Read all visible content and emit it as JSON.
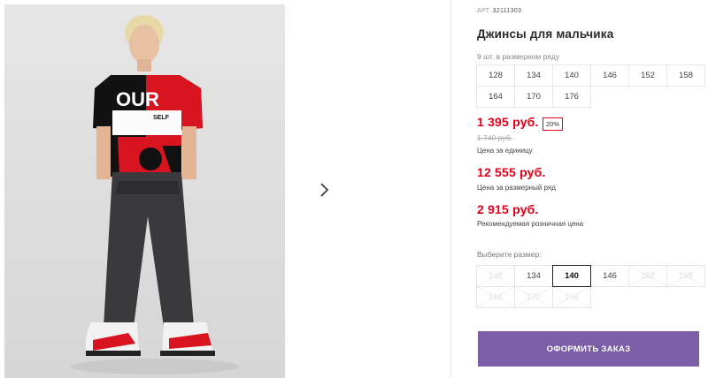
{
  "product": {
    "article_label": "АРТ.",
    "article_number": "32111303",
    "title": "Джинсы для мальчика",
    "series_note": "9 шт. в размерном ряду"
  },
  "series_sizes": [
    "128",
    "134",
    "140",
    "146",
    "152",
    "158",
    "164",
    "170",
    "176"
  ],
  "pricing": {
    "unit_price": "1 395 руб.",
    "discount": "20%",
    "old_price": "1 740 руб.",
    "unit_price_note": "Цена за единицу",
    "series_price": "12 555 руб.",
    "series_price_note": "Цена за размерный ряд",
    "retail_price": "2 915 руб.",
    "retail_price_note": "Рекомендуемая розничная цена"
  },
  "size_picker": {
    "label": "Выберите размер:",
    "sizes": [
      {
        "label": "128",
        "available": false
      },
      {
        "label": "134",
        "available": true
      },
      {
        "label": "140",
        "available": true,
        "selected": true
      },
      {
        "label": "146",
        "available": true
      },
      {
        "label": "152",
        "available": false
      },
      {
        "label": "158",
        "available": false
      },
      {
        "label": "164",
        "available": false
      },
      {
        "label": "170",
        "available": false
      },
      {
        "label": "176",
        "available": false
      }
    ]
  },
  "order_button": "ОФОРМИТЬ ЗАКАЗ",
  "gallery": {
    "next_icon": "chevron-right-icon",
    "photo_shirt_print": "OUR",
    "photo_shirt_sub": "SELF"
  },
  "colors": {
    "price_red": "#e0001b",
    "order_purple": "#7b5ea7"
  }
}
